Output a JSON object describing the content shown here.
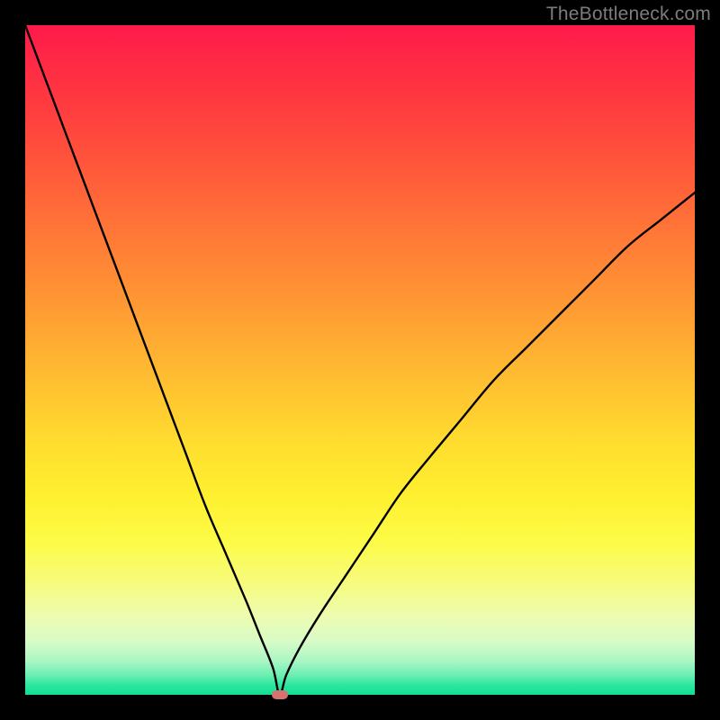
{
  "watermark": "TheBottleneck.com",
  "colors": {
    "frame": "#000000",
    "curve": "#000000",
    "marker": "#d6726f"
  },
  "chart_data": {
    "type": "line",
    "title": "",
    "xlabel": "",
    "ylabel": "",
    "xlim": [
      0,
      100
    ],
    "ylim": [
      0,
      100
    ],
    "grid": false,
    "note": "V-shaped bottleneck curve. y represents bottleneck percentage (0 = no bottleneck, top of plot = 100). Minimum occurs near x≈38 (marker). Background is a vertical gradient from red (high bottleneck) through orange/yellow to green (low bottleneck).",
    "marker": {
      "x": 38,
      "y": 0
    },
    "series": [
      {
        "name": "bottleneck-curve",
        "x": [
          0,
          3,
          6,
          9,
          12,
          15,
          18,
          21,
          24,
          27,
          30,
          33,
          35,
          37,
          38,
          39,
          41,
          44,
          48,
          52,
          56,
          60,
          65,
          70,
          75,
          80,
          85,
          90,
          95,
          100
        ],
        "y": [
          100,
          92,
          84,
          76,
          68,
          60,
          52,
          44,
          36,
          28,
          21,
          14,
          9,
          4,
          0,
          3,
          7,
          12,
          18,
          24,
          30,
          35,
          41,
          47,
          52,
          57,
          62,
          67,
          71,
          75
        ]
      }
    ]
  }
}
